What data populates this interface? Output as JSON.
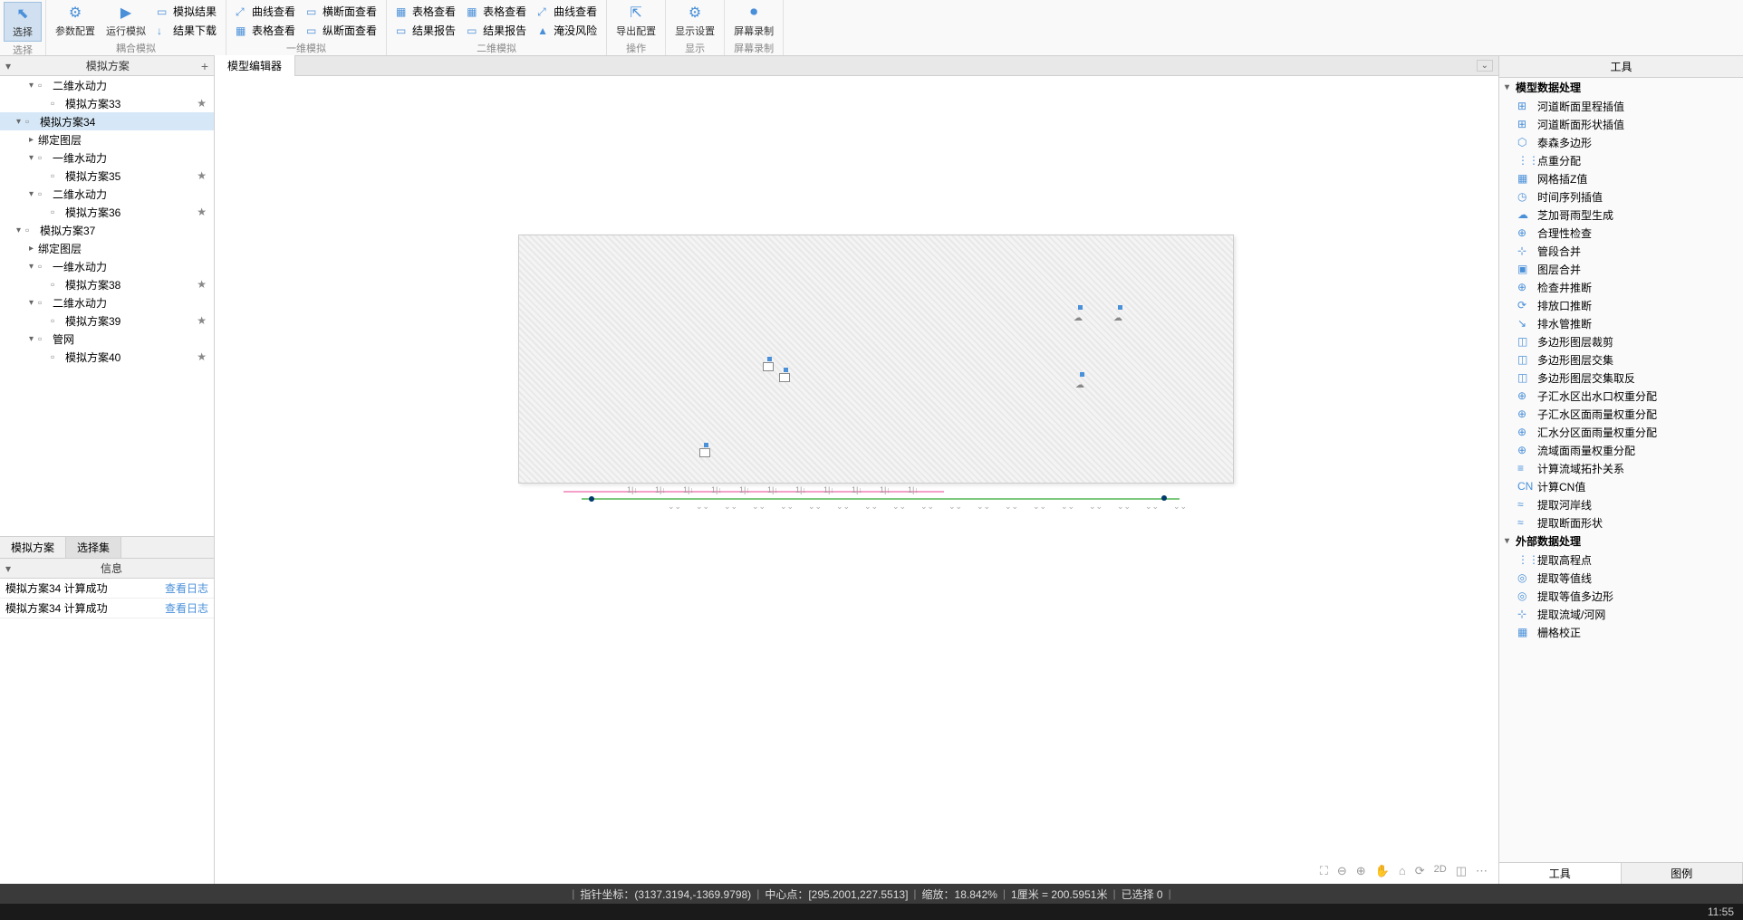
{
  "ribbon": {
    "groups": [
      {
        "label": "选择",
        "buttons_large": [
          {
            "icon": "⬉",
            "label": "选择",
            "name": "select-tool",
            "active": true
          }
        ]
      },
      {
        "label": "耦合模拟",
        "buttons_large": [
          {
            "icon": "⚙",
            "label": "参数配置",
            "name": "param-config"
          },
          {
            "icon": "▶",
            "label": "运行模拟",
            "name": "run-simulation"
          }
        ],
        "buttons_small": [
          {
            "icon": "▭",
            "label": "模拟结果",
            "name": "sim-results"
          },
          {
            "icon": "↓",
            "label": "结果下载",
            "name": "download-results"
          }
        ]
      },
      {
        "label": "一维模拟",
        "buttons_small_cols": [
          [
            {
              "icon": "⤢",
              "label": "曲线查看",
              "name": "curve-view-1d"
            },
            {
              "icon": "▦",
              "label": "表格查看",
              "name": "table-view-1d"
            }
          ],
          [
            {
              "icon": "▭",
              "label": "横断面查看",
              "name": "cross-section-view"
            },
            {
              "icon": "▭",
              "label": "纵断面查看",
              "name": "long-section-view"
            }
          ]
        ]
      },
      {
        "label": "二维模拟",
        "buttons_small_cols": [
          [
            {
              "icon": "▦",
              "label": "表格查看",
              "name": "table-view-2d"
            },
            {
              "icon": "▭",
              "label": "结果报告",
              "name": "result-report-2d"
            }
          ],
          [
            {
              "icon": "▦",
              "label": "表格查看",
              "name": "table-view-2d-b"
            },
            {
              "icon": "▭",
              "label": "结果报告",
              "name": "result-report-2d-b"
            }
          ],
          [
            {
              "icon": "⤢",
              "label": "曲线查看",
              "name": "curve-view-2d"
            },
            {
              "icon": "▲",
              "label": "淹没风险",
              "name": "flood-risk"
            }
          ]
        ]
      },
      {
        "label": "操作",
        "buttons_large": [
          {
            "icon": "⇱",
            "label": "导出配置",
            "name": "export-config"
          }
        ]
      },
      {
        "label": "显示",
        "buttons_large": [
          {
            "icon": "⚙",
            "label": "显示设置",
            "name": "display-settings"
          }
        ]
      },
      {
        "label": "屏幕录制",
        "buttons_large": [
          {
            "icon": "⏺",
            "label": "屏幕录制",
            "name": "screen-record"
          }
        ]
      }
    ]
  },
  "left": {
    "header": "模拟方案",
    "tree": [
      {
        "indent": 2,
        "expander": "▾",
        "icon": "▫",
        "label": "二维水动力",
        "name": "node-2d-hydro-1"
      },
      {
        "indent": 3,
        "expander": "",
        "icon": "▫",
        "label": "模拟方案33",
        "star": true,
        "name": "node-scheme-33"
      },
      {
        "indent": 1,
        "expander": "▾",
        "icon": "▫",
        "label": "模拟方案34",
        "selected": true,
        "name": "node-scheme-34"
      },
      {
        "indent": 2,
        "expander": "▸",
        "icon": "",
        "label": "绑定图层",
        "name": "node-bind-layer-34"
      },
      {
        "indent": 2,
        "expander": "▾",
        "icon": "▫",
        "label": "一维水动力",
        "name": "node-1d-hydro-34"
      },
      {
        "indent": 3,
        "expander": "",
        "icon": "▫",
        "label": "模拟方案35",
        "star": true,
        "name": "node-scheme-35"
      },
      {
        "indent": 2,
        "expander": "▾",
        "icon": "▫",
        "label": "二维水动力",
        "name": "node-2d-hydro-34"
      },
      {
        "indent": 3,
        "expander": "",
        "icon": "▫",
        "label": "模拟方案36",
        "star": true,
        "name": "node-scheme-36"
      },
      {
        "indent": 1,
        "expander": "▾",
        "icon": "▫",
        "label": "模拟方案37",
        "name": "node-scheme-37"
      },
      {
        "indent": 2,
        "expander": "▸",
        "icon": "",
        "label": "绑定图层",
        "name": "node-bind-layer-37"
      },
      {
        "indent": 2,
        "expander": "▾",
        "icon": "▫",
        "label": "一维水动力",
        "name": "node-1d-hydro-37"
      },
      {
        "indent": 3,
        "expander": "",
        "icon": "▫",
        "label": "模拟方案38",
        "star": true,
        "name": "node-scheme-38"
      },
      {
        "indent": 2,
        "expander": "▾",
        "icon": "▫",
        "label": "二维水动力",
        "name": "node-2d-hydro-37"
      },
      {
        "indent": 3,
        "expander": "",
        "icon": "▫",
        "label": "模拟方案39",
        "star": true,
        "name": "node-scheme-39"
      },
      {
        "indent": 2,
        "expander": "▾",
        "icon": "▫",
        "label": "管网",
        "name": "node-pipe-37"
      },
      {
        "indent": 3,
        "expander": "",
        "icon": "▫",
        "label": "模拟方案40",
        "star": true,
        "name": "node-scheme-40"
      }
    ],
    "tabs": [
      {
        "label": "模拟方案",
        "active": false
      },
      {
        "label": "选择集",
        "active": true
      }
    ],
    "info": {
      "header": "信息",
      "rows": [
        {
          "text": "模拟方案34 计算成功",
          "link": "查看日志"
        },
        {
          "text": "模拟方案34 计算成功",
          "link": "查看日志"
        }
      ]
    }
  },
  "center": {
    "tab": "模型编辑器",
    "close": "⌄"
  },
  "right": {
    "header": "工具",
    "groups": [
      {
        "label": "模型数据处理",
        "items": [
          {
            "icon": "⊞",
            "label": "河道断面里程插值",
            "name": "tool-mileage-interp"
          },
          {
            "icon": "⊞",
            "label": "河道断面形状插值",
            "name": "tool-shape-interp"
          },
          {
            "icon": "⬡",
            "label": "泰森多边形",
            "name": "tool-thiessen"
          },
          {
            "icon": "⋮⋮",
            "label": "点重分配",
            "name": "tool-point-redist"
          },
          {
            "icon": "▦",
            "label": "网格插Z值",
            "name": "tool-grid-z"
          },
          {
            "icon": "◷",
            "label": "时间序列插值",
            "name": "tool-timeseries"
          },
          {
            "icon": "☁",
            "label": "芝加哥雨型生成",
            "name": "tool-chicago-rain"
          },
          {
            "icon": "⊕",
            "label": "合理性检查",
            "name": "tool-validity-check"
          },
          {
            "icon": "⊹",
            "label": "管段合并",
            "name": "tool-pipe-merge"
          },
          {
            "icon": "▣",
            "label": "图层合并",
            "name": "tool-layer-merge"
          },
          {
            "icon": "⊕",
            "label": "检查井推断",
            "name": "tool-manhole-infer"
          },
          {
            "icon": "⟳",
            "label": "排放口推断",
            "name": "tool-outfall-infer"
          },
          {
            "icon": "↘",
            "label": "排水管推断",
            "name": "tool-drain-infer"
          },
          {
            "icon": "◫",
            "label": "多边形图层裁剪",
            "name": "tool-poly-clip"
          },
          {
            "icon": "◫",
            "label": "多边形图层交集",
            "name": "tool-poly-intersect"
          },
          {
            "icon": "◫",
            "label": "多边形图层交集取反",
            "name": "tool-poly-diff"
          },
          {
            "icon": "⊕",
            "label": "子汇水区出水口权重分配",
            "name": "tool-subcatch-outlet"
          },
          {
            "icon": "⊕",
            "label": "子汇水区面雨量权重分配",
            "name": "tool-subcatch-rain"
          },
          {
            "icon": "⊕",
            "label": "汇水分区面雨量权重分配",
            "name": "tool-catchment-rain"
          },
          {
            "icon": "⊕",
            "label": "流域面雨量权重分配",
            "name": "tool-basin-rain"
          },
          {
            "icon": "≡",
            "label": "计算流域拓扑关系",
            "name": "tool-topology"
          },
          {
            "icon": "CN",
            "label": "计算CN值",
            "name": "tool-cn"
          },
          {
            "icon": "≈",
            "label": "提取河岸线",
            "name": "tool-extract-bank"
          },
          {
            "icon": "≈",
            "label": "提取断面形状",
            "name": "tool-extract-section"
          }
        ]
      },
      {
        "label": "外部数据处理",
        "items": [
          {
            "icon": "⋮⋮",
            "label": "提取高程点",
            "name": "tool-extract-elev"
          },
          {
            "icon": "◎",
            "label": "提取等值线",
            "name": "tool-extract-contour"
          },
          {
            "icon": "◎",
            "label": "提取等值多边形",
            "name": "tool-extract-contour-poly"
          },
          {
            "icon": "⊹",
            "label": "提取流域/河网",
            "name": "tool-extract-basin"
          },
          {
            "icon": "▦",
            "label": "栅格校正",
            "name": "tool-raster-correct"
          }
        ]
      }
    ],
    "tabs": [
      {
        "label": "工具",
        "active": true
      },
      {
        "label": "图例",
        "active": false
      }
    ]
  },
  "status": {
    "pointer": "指针坐标：(3137.3194,-1369.9798)",
    "center": "中心点：[295.2001,227.5513]",
    "zoom": "缩放：18.842%",
    "scale": "1厘米 = 200.5951米",
    "selected": "已选择 0"
  },
  "bottom_time": "11:55"
}
